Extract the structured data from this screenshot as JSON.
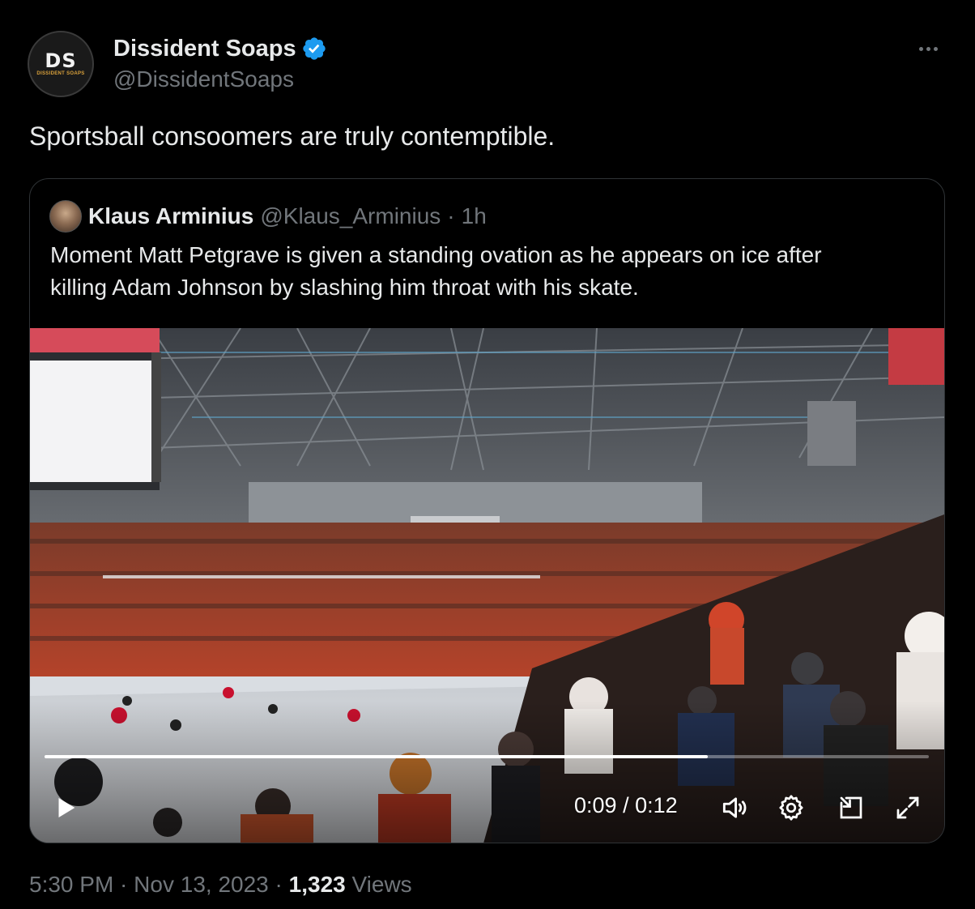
{
  "author": {
    "display_name": "Dissident Soaps",
    "handle": "@DissidentSoaps",
    "avatar_text": "DS",
    "avatar_subtext": "DISSIDENT SOAPS",
    "verified_color": "#1d9bf0"
  },
  "tweet": {
    "text": "Sportsball consoomers are truly contemptible."
  },
  "quoted": {
    "display_name": "Klaus Arminius",
    "handle": "@Klaus_Arminius",
    "separator": "·",
    "time": "1h",
    "text_lines": [
      "Moment Matt Petgrave is given a standing ovation as he appears on ice after",
      "killing Adam Johnson by slashing him throat with his skate."
    ]
  },
  "video": {
    "current_time": "0:09",
    "duration": "0:12",
    "time_separator": " / ",
    "progress": 0.75
  },
  "footer": {
    "time": "5:30 PM",
    "sep1": " · ",
    "date": "Nov 13, 2023",
    "sep2": " · ",
    "views_count": "1,323",
    "views_label": " Views"
  },
  "colors": {
    "background": "#000000",
    "text_primary": "#e7e9ea",
    "text_secondary": "#71767b",
    "border": "#2f3336",
    "accent": "#1d9bf0"
  }
}
